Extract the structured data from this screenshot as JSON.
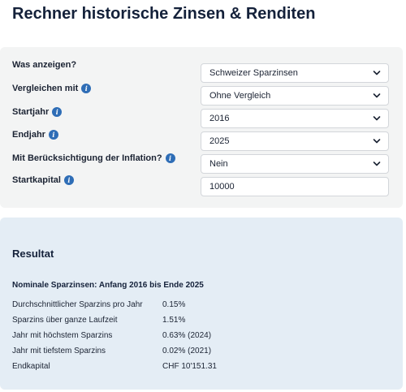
{
  "page": {
    "title": "Rechner historische Zinsen & Renditen"
  },
  "form": {
    "rows": [
      {
        "label": "Was anzeigen?",
        "info": false,
        "type": "select",
        "value": "Schweizer Sparzinsen"
      },
      {
        "label": "Vergleichen mit",
        "info": true,
        "type": "select",
        "value": "Ohne Vergleich"
      },
      {
        "label": "Startjahr",
        "info": true,
        "type": "select",
        "value": "2016"
      },
      {
        "label": "Endjahr",
        "info": true,
        "type": "select",
        "value": "2025"
      },
      {
        "label": "Mit Berücksichtigung der Inflation?",
        "info": true,
        "type": "select",
        "value": "Nein"
      },
      {
        "label": "Startkapital",
        "info": true,
        "type": "input",
        "value": "10000"
      }
    ],
    "info_glyph": "i"
  },
  "result": {
    "title": "Resultat",
    "subtitle": "Nominale Sparzinsen: Anfang 2016 bis Ende 2025",
    "rows": [
      {
        "label": "Durchschnittlicher Sparzins pro Jahr",
        "value": "0.15%"
      },
      {
        "label": "Sparzins über ganze Laufzeit",
        "value": "1.51%"
      },
      {
        "label": "Jahr mit höchstem Sparzins",
        "value": "0.63% (2024)"
      },
      {
        "label": "Jahr mit tiefstem Sparzins",
        "value": "0.02% (2021)"
      },
      {
        "label": "Endkapital",
        "value": "CHF 10'151.31"
      }
    ]
  },
  "colors": {
    "form_panel_bg": "#f3f4f4",
    "result_panel_bg": "#e4edf5",
    "info_icon": "#2e6db6",
    "heading_text": "#14213a"
  },
  "icons": {
    "info": "info-icon",
    "dropdown": "chevron-down-icon"
  }
}
